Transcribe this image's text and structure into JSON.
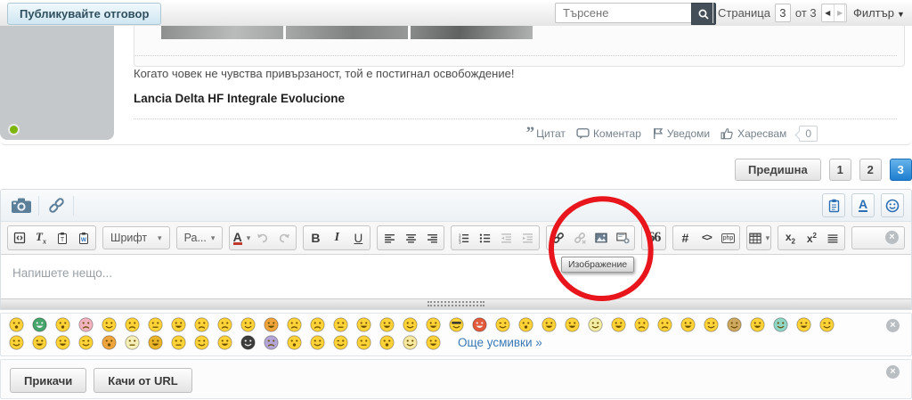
{
  "topbar": {
    "publish_label": "Публикувайте отговор",
    "search": {
      "placeholder": "Търсене",
      "button_icon": "magnifier-icon"
    },
    "pager": {
      "label": "Страница",
      "value": "3",
      "of_label": "от 3",
      "prev_glyph": "◀",
      "next_glyph": "▶"
    },
    "filter": {
      "label": "Филтър",
      "caret": "▼"
    }
  },
  "post": {
    "signature_text": "Когато човек не чувства привързаност, той е постигнал освобождение!",
    "signature_bold": "Lancia Delta HF Integrale Evolucione",
    "actions": [
      {
        "name": "quote-action",
        "icon": "quote-mark-icon",
        "label": "Цитат"
      },
      {
        "name": "comment-action",
        "icon": "comment-icon",
        "label": "Коментар"
      },
      {
        "name": "notify-action",
        "icon": "flag-icon",
        "label": "Уведоми"
      },
      {
        "name": "like-action",
        "icon": "thumb-up-icon",
        "label": "Харесвам"
      }
    ],
    "like_count": "0"
  },
  "pagination": {
    "prev_label": "Предишна",
    "pages": [
      "1",
      "2",
      "3"
    ],
    "active_page": "3"
  },
  "editor": {
    "header": {
      "left_buttons": [
        {
          "name": "photo-button",
          "icon": "camera-icon"
        },
        {
          "name": "link-button",
          "icon": "chain-icon"
        }
      ],
      "right_buttons": [
        {
          "name": "paste-mode-button",
          "icon": "clipboard-icon"
        },
        {
          "name": "bbcode-button",
          "icon": "font-a-icon",
          "glyph": "A"
        },
        {
          "name": "emoticons-button",
          "icon": "smiley-icon"
        }
      ]
    },
    "toolbar": {
      "close_glyph": "×",
      "groups": [
        {
          "kind": "buttons",
          "items": [
            {
              "name": "source-button",
              "icon": "source-icon"
            },
            {
              "name": "remove-format-button",
              "icon": "remove-format-icon",
              "glyph": "Tx"
            },
            {
              "name": "paste-plain-button",
              "icon": "paste-text-icon"
            },
            {
              "name": "paste-word-button",
              "icon": "paste-word-icon"
            }
          ]
        },
        {
          "kind": "select",
          "name": "font-select",
          "label": "Шрифт"
        },
        {
          "kind": "select",
          "name": "size-select",
          "label": "Ра..."
        },
        {
          "kind": "buttons",
          "items": [
            {
              "name": "text-color-button",
              "icon": "text-color-icon",
              "glyph": "A",
              "caret": true
            },
            {
              "name": "undo-button",
              "icon": "undo-icon",
              "disabled": true
            },
            {
              "name": "redo-button",
              "icon": "redo-icon",
              "disabled": true
            }
          ]
        },
        {
          "kind": "buttons",
          "items": [
            {
              "name": "bold-button",
              "icon": "bold-icon",
              "glyph": "B"
            },
            {
              "name": "italic-button",
              "icon": "italic-icon",
              "glyph": "I"
            },
            {
              "name": "underline-button",
              "icon": "underline-icon",
              "glyph": "U"
            }
          ]
        },
        {
          "kind": "buttons",
          "items": [
            {
              "name": "align-left-button",
              "icon": "align-left-icon"
            },
            {
              "name": "align-center-button",
              "icon": "align-center-icon"
            },
            {
              "name": "align-right-button",
              "icon": "align-right-icon"
            }
          ]
        },
        {
          "kind": "buttons",
          "items": [
            {
              "name": "ordered-list-button",
              "icon": "list-ol-icon"
            },
            {
              "name": "bullet-list-button",
              "icon": "list-ul-icon"
            },
            {
              "name": "outdent-button",
              "icon": "outdent-icon",
              "disabled": true
            },
            {
              "name": "indent-button",
              "icon": "indent-icon",
              "disabled": true
            }
          ]
        },
        {
          "kind": "buttons",
          "items": [
            {
              "name": "insert-link-button",
              "icon": "link-icon"
            },
            {
              "name": "unlink-button",
              "icon": "unlink-icon",
              "disabled": true
            },
            {
              "name": "image-button",
              "icon": "image-icon"
            },
            {
              "name": "media-button",
              "icon": "media-icon"
            }
          ]
        },
        {
          "kind": "buttons",
          "items": [
            {
              "name": "quote-button",
              "icon": "quote-icon",
              "glyph": "66"
            }
          ]
        },
        {
          "kind": "buttons",
          "items": [
            {
              "name": "hash-code-button",
              "icon": "hash-icon",
              "glyph": "#"
            },
            {
              "name": "html-code-button",
              "icon": "code-icon",
              "glyph": "<>"
            },
            {
              "name": "php-code-button",
              "icon": "php-icon",
              "glyph": "php"
            }
          ]
        },
        {
          "kind": "buttons",
          "items": [
            {
              "name": "table-button",
              "icon": "table-icon",
              "caret": true
            }
          ]
        },
        {
          "kind": "buttons",
          "items": [
            {
              "name": "subscript-button",
              "icon": "subscript-icon",
              "glyph": "x2"
            },
            {
              "name": "superscript-button",
              "icon": "superscript-icon",
              "glyph": "x2"
            },
            {
              "name": "horizontal-rule-button",
              "icon": "horizontal-rule-icon"
            }
          ]
        },
        {
          "kind": "empty",
          "name": "plugin-slot"
        }
      ]
    },
    "tooltip": "Изображение",
    "content_placeholder": "Напишете нещо...",
    "emoticons": {
      "more_label": "Още усмивки »",
      "row1": [
        [
          "#ffd338",
          "o"
        ],
        [
          "#45a56b",
          "grin"
        ],
        [
          "#ffd338",
          "o"
        ],
        [
          "#f2b3c0",
          "sad"
        ],
        [
          "#ffd338",
          "smile"
        ],
        [
          "#ffd338",
          "sad"
        ],
        [
          "#ffd338",
          "neutral"
        ],
        [
          "#ffd338",
          "grin"
        ],
        [
          "#ffd338",
          "sad"
        ],
        [
          "#ffd338",
          "sad"
        ],
        [
          "#ffd338",
          "smile"
        ],
        [
          "#f0a43c",
          "grin"
        ],
        [
          "#ffd338",
          "sad"
        ],
        [
          "#ffd338",
          "sad"
        ],
        [
          "#ffd338",
          "neutral"
        ],
        [
          "#ffd338",
          "grin"
        ],
        [
          "#ffd338",
          "grin"
        ],
        [
          "#ffd338",
          "smile"
        ],
        [
          "#ffd338",
          "grin"
        ],
        [
          "#ffd338",
          "cool"
        ],
        [
          "#e2593b",
          "grin"
        ],
        [
          "#ffd338",
          "wink"
        ],
        [
          "#ffd338",
          "o"
        ],
        [
          "#ffd338",
          "grin"
        ],
        [
          "#ffd338",
          "grin"
        ],
        [
          "#f3eda4",
          "smile"
        ],
        [
          "#ffd338",
          "grin"
        ],
        [
          "#ffd338",
          "sad"
        ],
        [
          "#ffd338",
          "sad"
        ],
        [
          "#ffd338",
          "grin"
        ],
        [
          "#ffd338",
          "wink"
        ],
        [
          "#cfa85f",
          "smile"
        ],
        [
          "#ffd338",
          "grin"
        ],
        [
          "#8fd6c6",
          "smile"
        ],
        [
          "#ffd338",
          "grin"
        ],
        [
          "#ffd338",
          "wink"
        ]
      ],
      "row2": [
        [
          "#ffd338",
          "smile"
        ],
        [
          "#ffd338",
          "grin"
        ],
        [
          "#ffd338",
          "grin"
        ],
        [
          "#ffd338",
          "wink"
        ],
        [
          "#f0a43c",
          "o"
        ],
        [
          "#f6f0b8",
          "neutral"
        ],
        [
          "#eab429",
          "grin"
        ],
        [
          "#ffd338",
          "neutral"
        ],
        [
          "#ffd338",
          "wink"
        ],
        [
          "#ffd338",
          "grin"
        ],
        [
          "#3c3c3c",
          "smile"
        ],
        [
          "#b3a6d6",
          "sad"
        ],
        [
          "#ffd338",
          "o"
        ],
        [
          "#ffd338",
          "smile"
        ],
        [
          "#ffd338",
          "wink"
        ],
        [
          "#ffd338",
          "neutral"
        ],
        [
          "#ffd338",
          "o"
        ],
        [
          "#f7e9a0",
          "smile"
        ],
        [
          "#ffd338",
          "grin"
        ]
      ]
    },
    "attachments": {
      "attach_label": "Прикачи",
      "upload_url_label": "Качи от URL"
    },
    "close_glyph": "×"
  },
  "colors": {
    "accent_blue": "#2a84d2",
    "annotation_red": "#e8151c",
    "link_blue": "#3b79b5",
    "icon_steel": "#5b7e99"
  }
}
